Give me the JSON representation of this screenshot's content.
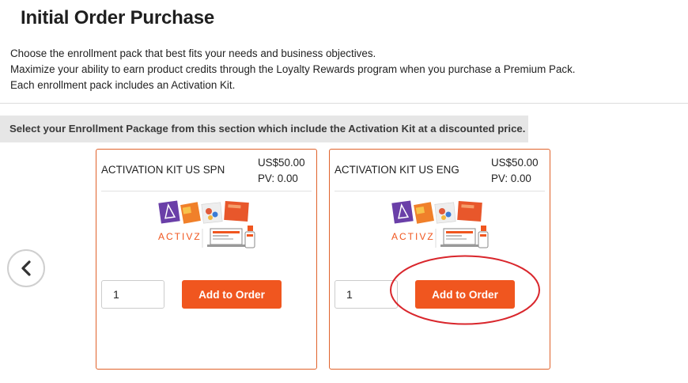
{
  "page": {
    "title": "Initial Order Purchase",
    "intro_lines": [
      "Choose the enrollment pack that best fits your needs and business objectives.",
      "Maximize your ability to earn product credits through the Loyalty Rewards program when you purchase a Premium Pack.",
      "Each enrollment pack includes an Activation Kit."
    ],
    "section_banner": "Select your Enrollment Package from this section which include the Activation Kit at a discounted price."
  },
  "carousel": {
    "prev_icon": "chevron-left-icon"
  },
  "products": [
    {
      "name": "ACTIVATION KIT US SPN",
      "price": "US$50.00",
      "pv": "PV: 0.00",
      "brand": "ACTIVZ",
      "quantity": "1",
      "button_label": "Add to Order"
    },
    {
      "name": "ACTIVATION KIT US ENG",
      "price": "US$50.00",
      "pv": "PV: 0.00",
      "brand": "ACTIVZ",
      "quantity": "1",
      "button_label": "Add to Order"
    }
  ],
  "colors": {
    "accent": "#f0561f",
    "card_border": "#e0622b",
    "highlight": "#d9262c",
    "banner_bg": "#e6e6e6"
  }
}
